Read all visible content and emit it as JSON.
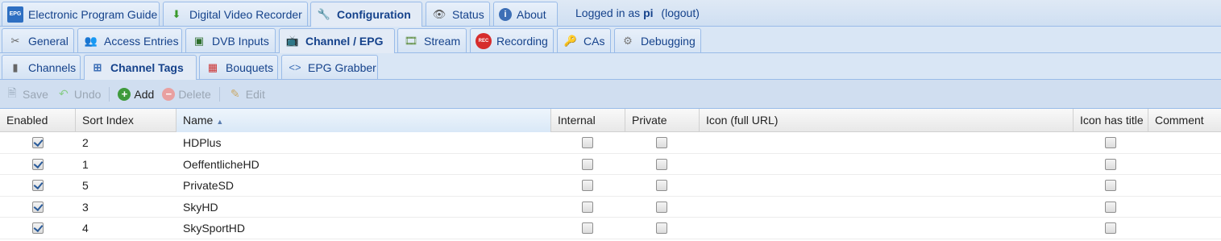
{
  "top_tabs": [
    {
      "label": "Electronic Program Guide",
      "icon": "epg-icon"
    },
    {
      "label": "Digital Video Recorder",
      "icon": "download-icon"
    },
    {
      "label": "Configuration",
      "icon": "wrench-icon",
      "active": true
    },
    {
      "label": "Status",
      "icon": "eye-icon"
    },
    {
      "label": "About",
      "icon": "info-icon"
    }
  ],
  "login": {
    "prefix": "Logged in as",
    "user": "pi",
    "logout": "(logout)"
  },
  "config_tabs": [
    {
      "label": "General",
      "icon": "tools-icon"
    },
    {
      "label": "Access Entries",
      "icon": "users-icon"
    },
    {
      "label": "DVB Inputs",
      "icon": "card-icon"
    },
    {
      "label": "Channel / EPG",
      "icon": "tv-icon",
      "active": true
    },
    {
      "label": "Stream",
      "icon": "film-icon"
    },
    {
      "label": "Recording",
      "icon": "rec-icon"
    },
    {
      "label": "CAs",
      "icon": "key-icon"
    },
    {
      "label": "Debugging",
      "icon": "gears-icon"
    }
  ],
  "sub_tabs": [
    {
      "label": "Channels",
      "icon": "remote-icon"
    },
    {
      "label": "Channel Tags",
      "icon": "tree-icon",
      "active": true
    },
    {
      "label": "Bouquets",
      "icon": "grid-icon"
    },
    {
      "label": "EPG Grabber",
      "icon": "code-icon"
    }
  ],
  "toolbar": {
    "save": "Save",
    "undo": "Undo",
    "add": "Add",
    "delete": "Delete",
    "edit": "Edit"
  },
  "columns": {
    "enabled": "Enabled",
    "sort_index": "Sort Index",
    "name": "Name",
    "internal": "Internal",
    "private": "Private",
    "icon": "Icon (full URL)",
    "icon_has_title": "Icon has title",
    "comment": "Comment"
  },
  "rows": [
    {
      "enabled": true,
      "sort_index": "2",
      "name": "HDPlus",
      "internal": false,
      "private": false,
      "icon": "",
      "icon_has_title": false,
      "comment": ""
    },
    {
      "enabled": true,
      "sort_index": "1",
      "name": "OeffentlicheHD",
      "internal": false,
      "private": false,
      "icon": "",
      "icon_has_title": false,
      "comment": ""
    },
    {
      "enabled": true,
      "sort_index": "5",
      "name": "PrivateSD",
      "internal": false,
      "private": false,
      "icon": "",
      "icon_has_title": false,
      "comment": ""
    },
    {
      "enabled": true,
      "sort_index": "3",
      "name": "SkyHD",
      "internal": false,
      "private": false,
      "icon": "",
      "icon_has_title": false,
      "comment": ""
    },
    {
      "enabled": true,
      "sort_index": "4",
      "name": "SkySportHD",
      "internal": false,
      "private": false,
      "icon": "",
      "icon_has_title": false,
      "comment": ""
    }
  ]
}
